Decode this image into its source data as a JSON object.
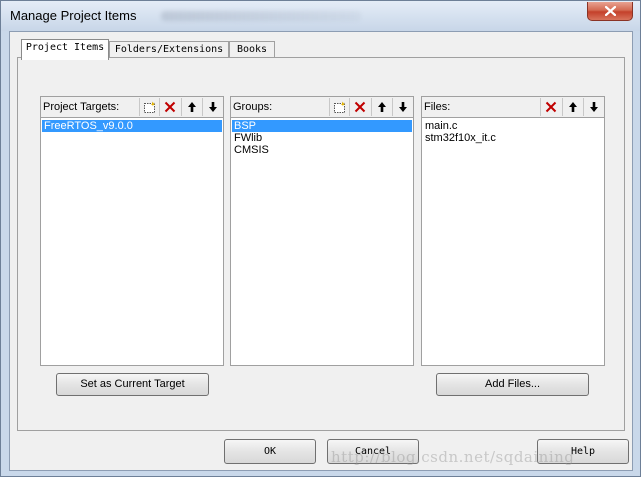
{
  "window": {
    "title": "Manage Project Items"
  },
  "tabs": [
    {
      "label": "Project Items"
    },
    {
      "label": "Folders/Extensions"
    },
    {
      "label": "Books"
    }
  ],
  "targets": {
    "label": "Project Targets:",
    "items": [
      "FreeRTOS_v9.0.0"
    ],
    "selected": 0,
    "action_label": "Set as Current Target"
  },
  "groups": {
    "label": "Groups:",
    "items": [
      "BSP",
      "FWlib",
      "CMSIS"
    ],
    "selected": 0
  },
  "files": {
    "label": "Files:",
    "items": [
      "main.c",
      "stm32f10x_it.c"
    ],
    "action_label": "Add Files..."
  },
  "dialog_buttons": {
    "ok": "OK",
    "cancel": "Cancel",
    "help": "Help"
  },
  "watermark": "http://blog.csdn.net/sqdaining",
  "icons": {
    "new": "new-item-icon",
    "delete": "delete-icon",
    "up": "move-up-icon",
    "down": "move-down-icon",
    "close": "close-icon"
  },
  "colors": {
    "selection": "#3399ff",
    "delete_red": "#c00000",
    "close_red": "#c4402a"
  }
}
